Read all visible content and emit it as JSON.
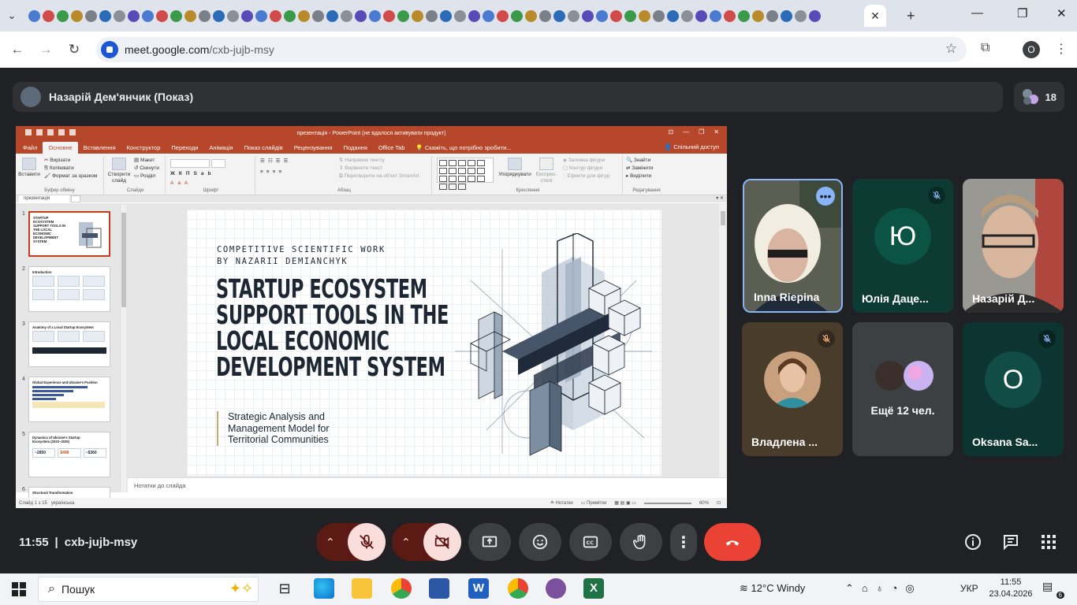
{
  "browser": {
    "url_host": "meet.google.com",
    "url_path": "/cxb-jujb-msy",
    "profile_initial": "O"
  },
  "meet": {
    "presenter_label": "Назарій Дем'янчик (Показ)",
    "participants_count": "18",
    "time": "11:55",
    "meeting_code": "cxb-jujb-msy",
    "tiles": [
      {
        "name": "Inna Riepina",
        "muted": false
      },
      {
        "name": "Юлія Даце...",
        "initial": "Ю",
        "muted": true
      },
      {
        "name": "Назарій Д...",
        "muted": false
      },
      {
        "name": "Владлена ...",
        "muted": true
      },
      {
        "name": "Ещё 12 чел.",
        "muted": false
      },
      {
        "name": "Oksana Sa...",
        "initial": "O",
        "muted": true
      }
    ],
    "colors": {
      "end_call": "#ea4335",
      "muted_control": "#f9dedc",
      "tile_bg": "#3c4043",
      "accent": "#8ab4f8"
    }
  },
  "powerpoint": {
    "window_title": "презентація - PowerPoint (не вдалося активувати продукт)",
    "menu": [
      "Файл",
      "Основне",
      "Вставлення",
      "Конструктор",
      "Переходи",
      "Анімація",
      "Показ слайдів",
      "Рецензування",
      "Подання",
      "Office Tab"
    ],
    "tell_me": "Скажіть, що потрібно зробити...",
    "share": "Спільний доступ",
    "ribbon": {
      "clipboard": {
        "paste": "Вставити",
        "cut": "Вирізати",
        "copy": "Копіювати",
        "format": "Формат за зразком",
        "caption": "Буфер обміну"
      },
      "slides": {
        "new": "Створити слайд",
        "layout": "Макет",
        "reset": "Скинути",
        "section": "Розділ",
        "caption": "Слайди"
      },
      "font": {
        "caption": "Шрифт"
      },
      "paragraph": {
        "dir": "Напрямок тексту",
        "align": "Вирівняти текст",
        "smartart": "Перетворити на об'єкт SmartArt",
        "caption": "Абзац"
      },
      "drawing": {
        "arrange": "Упорядкувати",
        "styles": "Експрес-стилі",
        "fill": "Заливка фігури",
        "outline": "Контур фігури",
        "effects": "Ефекти для фігур",
        "caption": "Креслення"
      },
      "editing": {
        "find": "Знайти",
        "replace": "Замінити",
        "select": "Виділити",
        "caption": "Редагування"
      }
    },
    "file_tab": "презентація",
    "thumbnails": [
      {
        "num": "1",
        "title": "STARTUP ECOSYSTEM SUPPORT TOOLS IN THE LOCAL ECONOMIC DEVELOPMENT SYSTEM"
      },
      {
        "num": "2",
        "title": "Introduction"
      },
      {
        "num": "3",
        "title": "Anatomy of a Local Startup Ecosystem"
      },
      {
        "num": "4",
        "title": "Global Experience and Ukraine's Position"
      },
      {
        "num": "5",
        "title": "Dynamics of Ukraine's Startup Ecosystem (2023–2025)",
        "values": [
          "~2850",
          "$498",
          "~$360"
        ]
      },
      {
        "num": "6",
        "title": "Structural Transformation"
      }
    ],
    "slide": {
      "subtitle_line1": "COMPETITIVE SCIENTIFIC WORK",
      "subtitle_line2": "BY NAZARII DEMIANCHYK",
      "title_line1": "STARTUP ECOSYSTEM",
      "title_line2": "SUPPORT TOOLS IN THE",
      "title_line3": "LOCAL ECONOMIC",
      "title_line4": "DEVELOPMENT SYSTEM",
      "body_line1": "Strategic Analysis and",
      "body_line2": "Management Model for",
      "body_line3": "Territorial Communities"
    },
    "notes_placeholder": "Нотатки до слайда",
    "status": {
      "slide": "Слайд 1 з 15",
      "lang": "українська",
      "notes": "Нотатки",
      "comments": "Примітки",
      "zoom": "60%"
    }
  },
  "taskbar": {
    "search_text": "Пошук",
    "weather": "12°C  Windy",
    "lang": "УКР",
    "time": "11:55",
    "date": "23.04.2026",
    "notifications": "6"
  }
}
